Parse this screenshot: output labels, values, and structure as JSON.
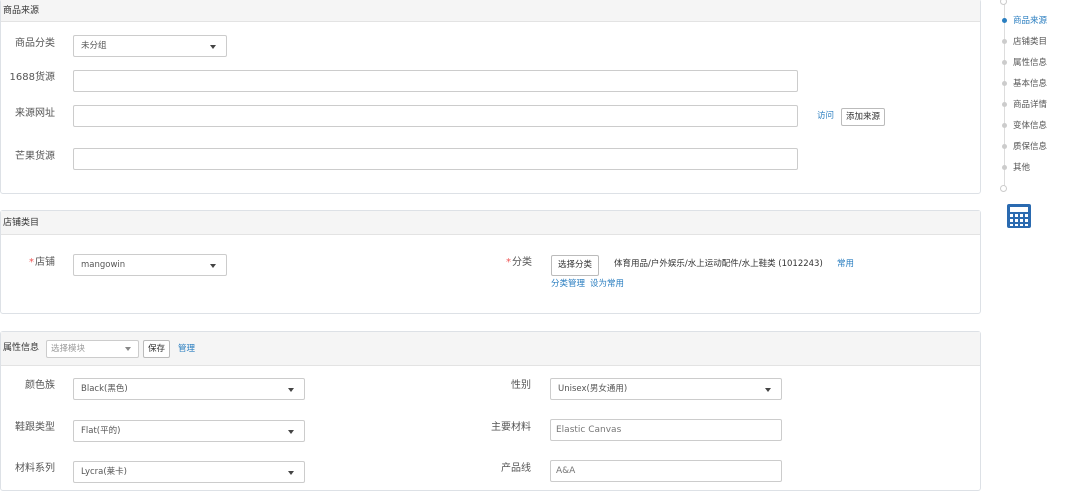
{
  "source": {
    "title": "商品来源",
    "category_label": "商品分类",
    "category_value": "未分组",
    "src1688_label": "1688货源",
    "src1688_value": "",
    "url_label": "来源网址",
    "url_value": "",
    "visit_link": "访问",
    "add_source_button": "添加来源",
    "mango_label": "芒果货源",
    "mango_value": ""
  },
  "store": {
    "title": "店铺类目",
    "store_label": "店铺",
    "store_value": "mangowin",
    "category_label": "分类",
    "select_category_button": "选择分类",
    "category_path": "体育用品/户外娱乐/水上运动配件/水上鞋类 (1012243)",
    "common_link": "常用",
    "manage_link": "分类管理",
    "set_common_link": "设为常用"
  },
  "attrs": {
    "title": "属性信息",
    "module_placeholder": "选择模块",
    "save_button": "保存",
    "manage_link": "管理",
    "color_label": "颜色族",
    "color_value": "Black(黑色)",
    "gender_label": "性别",
    "gender_value": "Unisex(男女通用)",
    "heel_label": "鞋跟类型",
    "heel_value": "Flat(平的)",
    "material_label": "主要材料",
    "material_value": "Elastic Canvas",
    "series_label": "材料系列",
    "series_value": "Lycra(莱卡)",
    "line_label": "产品线",
    "line_value": "A&A"
  },
  "nav": {
    "items": [
      "商品来源",
      "店铺类目",
      "属性信息",
      "基本信息",
      "商品详情",
      "变体信息",
      "质保信息",
      "其他"
    ],
    "active_index": 0,
    "calculator_icon": "calculator-icon"
  },
  "colors": {
    "accent": "#2a7ec0",
    "border": "#dde1e6",
    "header_bg": "#f5f5f5",
    "required": "#e55555"
  }
}
